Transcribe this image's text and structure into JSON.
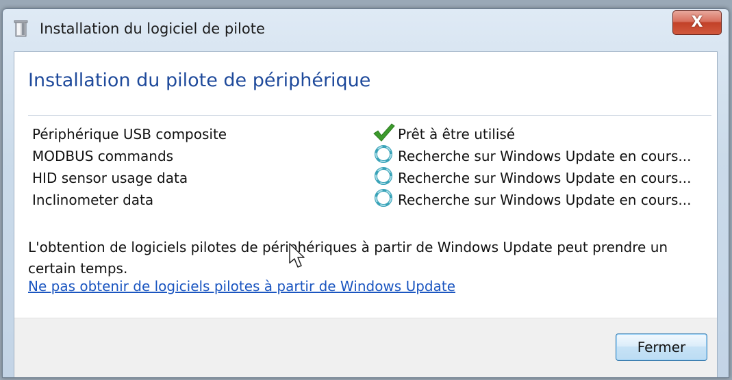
{
  "window": {
    "title": "Installation du logiciel de pilote",
    "close_glyph": "X",
    "icons": {
      "app": "driver-install-icon",
      "close": "close-icon"
    }
  },
  "main": {
    "heading": "Installation du pilote de périphérique",
    "devices": [
      {
        "name": "Périphérique USB composite",
        "status": "Prêt à être utilisé",
        "status_icon": "checkmark-icon",
        "status_color": "#3c9a2c"
      },
      {
        "name": "MODBUS commands",
        "status": "Recherche sur Windows Update en cours...",
        "status_icon": "searching-spinner-icon",
        "status_color": "#3aa3b8"
      },
      {
        "name": "HID sensor usage data",
        "status": "Recherche sur Windows Update en cours...",
        "status_icon": "searching-spinner-icon",
        "status_color": "#3aa3b8"
      },
      {
        "name": "Inclinometer data",
        "status": "Recherche sur Windows Update en cours...",
        "status_icon": "searching-spinner-icon",
        "status_color": "#3aa3b8"
      }
    ],
    "info": "L'obtention de logiciels pilotes de périphériques à partir de Windows Update peut prendre un certain temps.",
    "skip_link": "Ne pas obtenir de logiciels pilotes à partir de Windows Update"
  },
  "footer": {
    "close_label": "Fermer"
  },
  "colors": {
    "heading": "#1f4a9b",
    "link": "#1a55c0"
  }
}
